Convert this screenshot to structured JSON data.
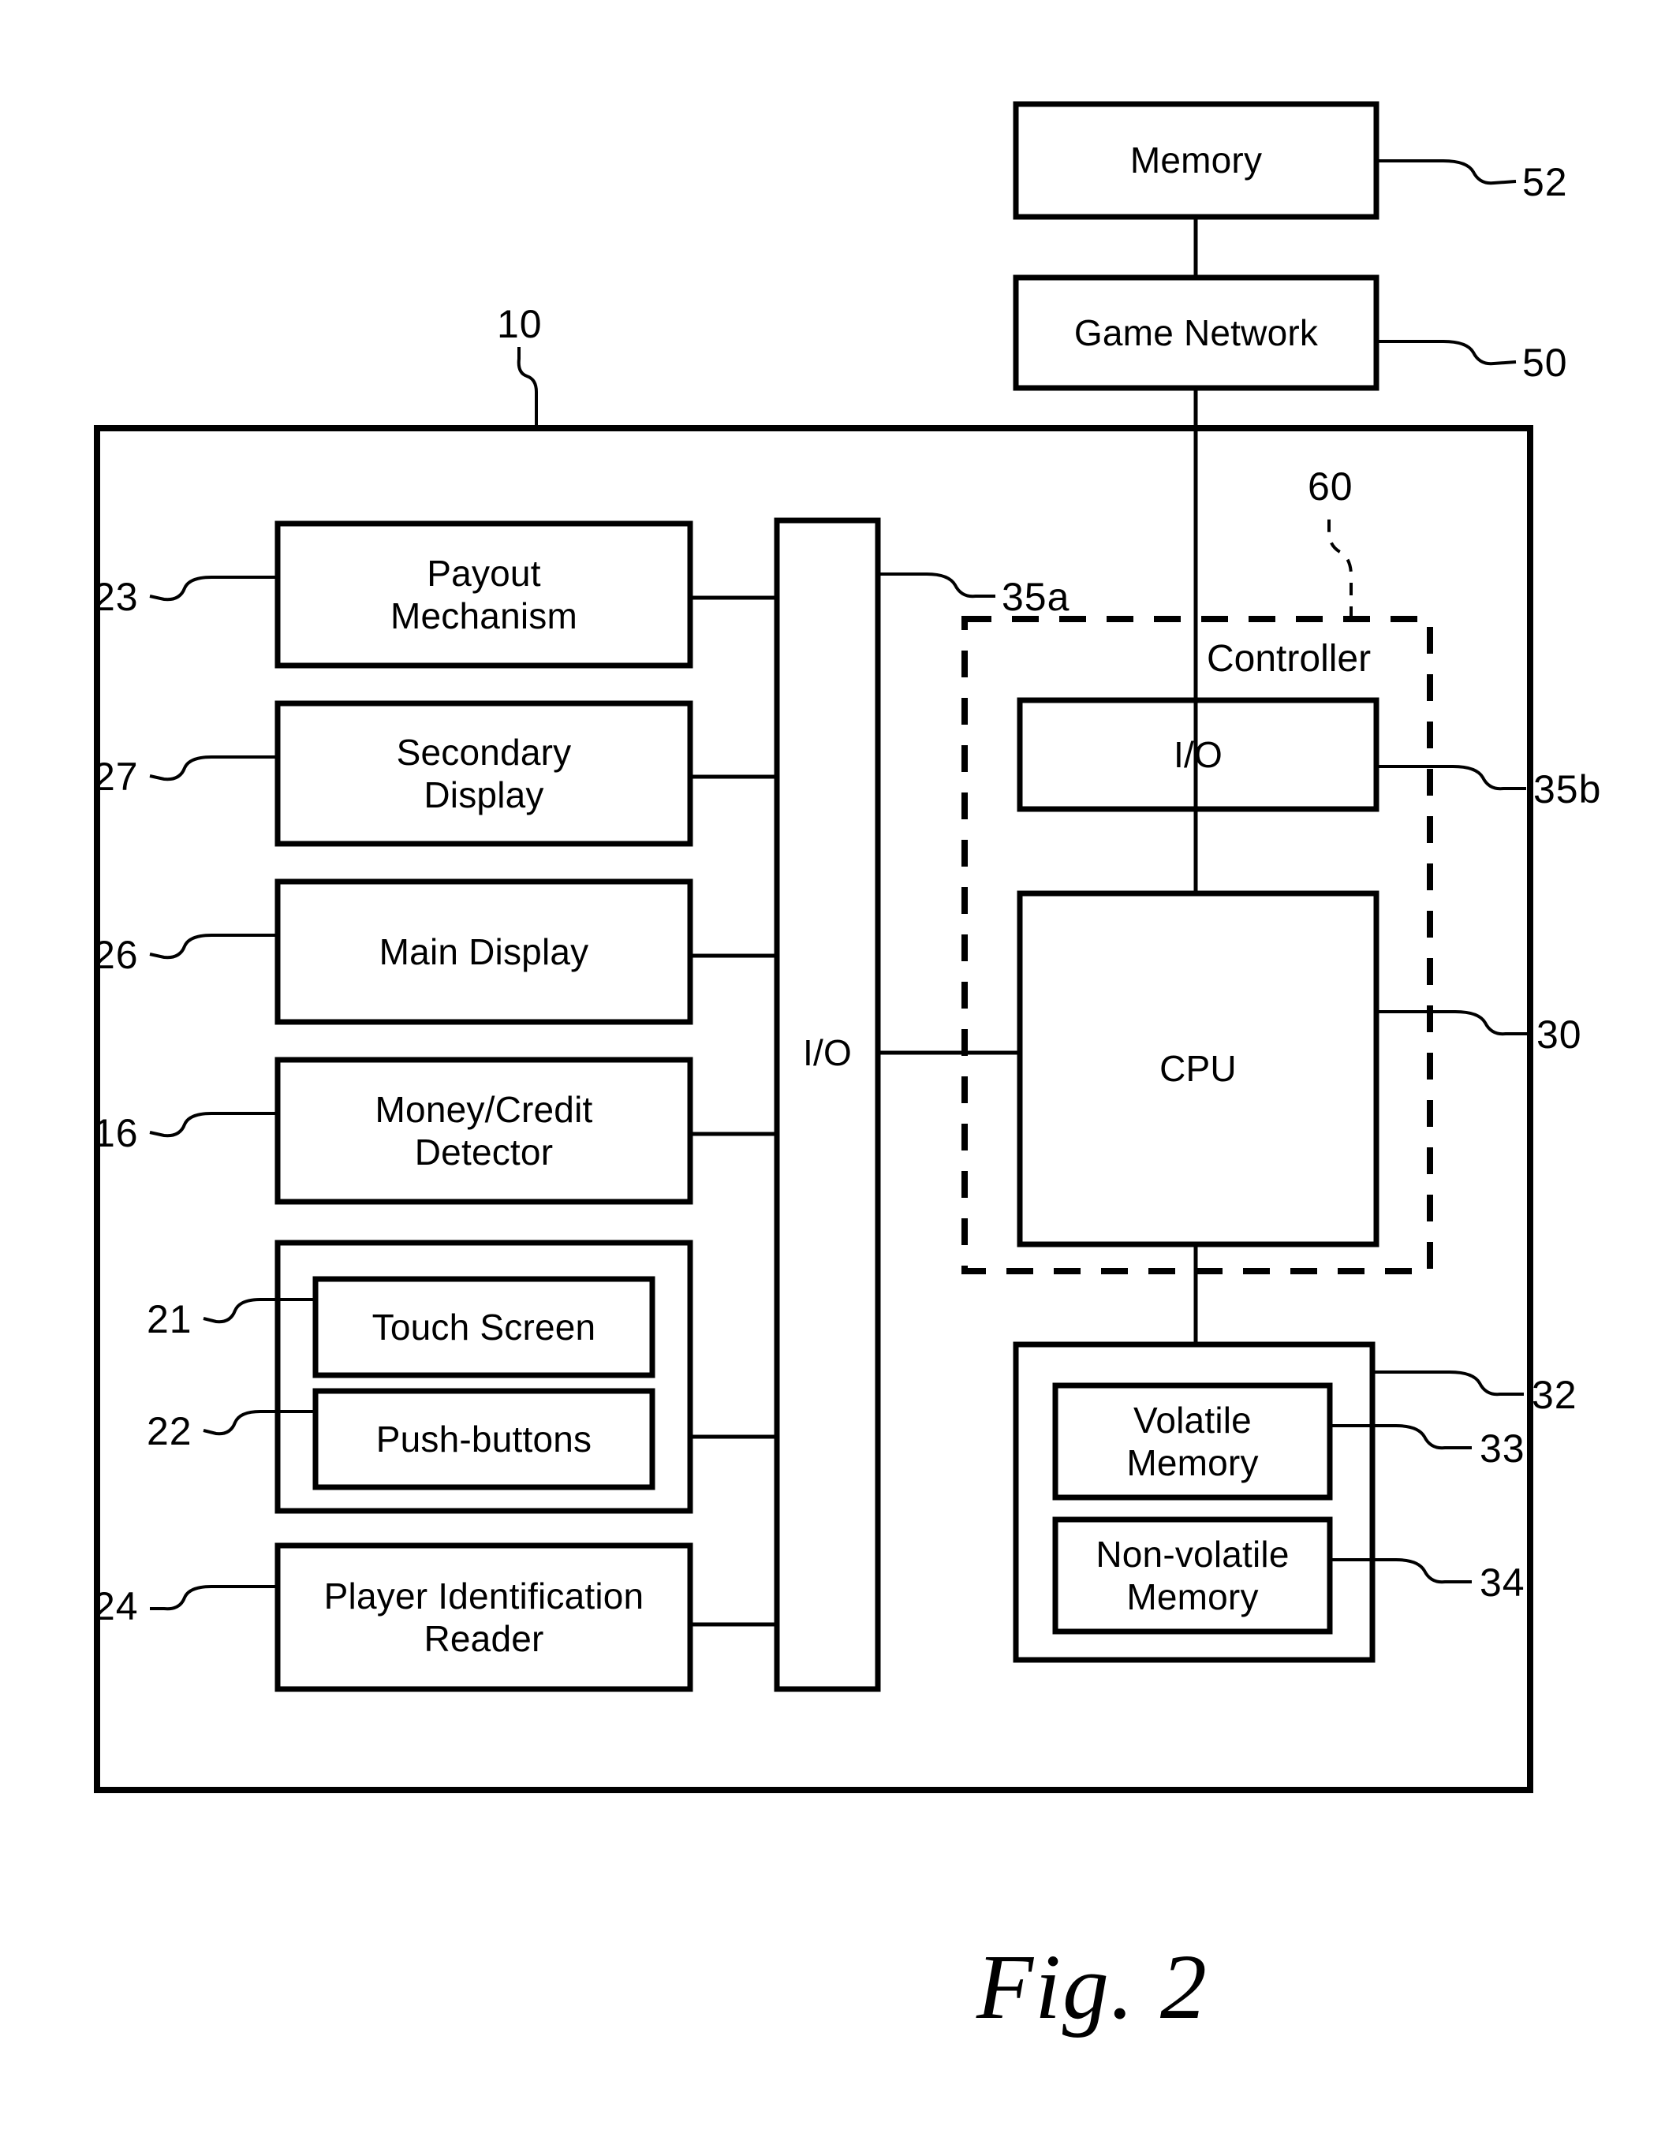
{
  "figure": {
    "caption": "Fig. 2",
    "system_ref": "10"
  },
  "external": {
    "memory": {
      "label": "Memory",
      "ref": "52"
    },
    "game_network": {
      "label": "Game Network",
      "ref": "50"
    }
  },
  "peripherals": [
    {
      "label": "Payout\nMechanism",
      "ref": "23"
    },
    {
      "label": "Secondary\nDisplay",
      "ref": "27"
    },
    {
      "label": "Main Display",
      "ref": "26"
    },
    {
      "label": "Money/Credit\nDetector",
      "ref": "16"
    },
    {
      "label": "Touch Screen",
      "ref": "21"
    },
    {
      "label": "Push-buttons",
      "ref": "22"
    },
    {
      "label": "Player Identification\nReader",
      "ref": "24"
    }
  ],
  "bus": {
    "io_label": "I/O",
    "io_ref": "35a"
  },
  "controller": {
    "label": "Controller",
    "ref": "60",
    "io": {
      "label": "I/O",
      "ref": "35b"
    },
    "cpu": {
      "label": "CPU",
      "ref": "30"
    }
  },
  "memory_group": {
    "ref": "32",
    "volatile": {
      "label": "Volatile\nMemory",
      "ref": "33"
    },
    "nonvolatile": {
      "label": "Non-volatile\nMemory",
      "ref": "34"
    }
  }
}
